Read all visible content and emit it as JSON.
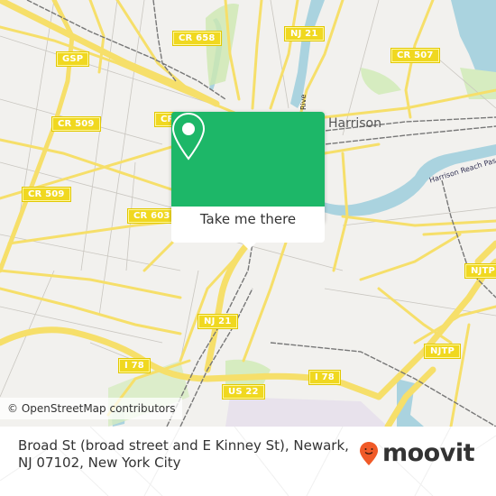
{
  "map": {
    "shields": [
      {
        "id": "cr658",
        "label": "CR 658"
      },
      {
        "id": "nj21-top",
        "label": "NJ 21"
      },
      {
        "id": "cr507",
        "label": "CR 507"
      },
      {
        "id": "gsp",
        "label": "GSP"
      },
      {
        "id": "cr509-a",
        "label": "CR 509"
      },
      {
        "id": "cr509-b",
        "label": "CR 509"
      },
      {
        "id": "cr603",
        "label": "CR 603"
      },
      {
        "id": "cr-partial",
        "label": "CR"
      },
      {
        "id": "nj21-mid",
        "label": "NJ 21"
      },
      {
        "id": "njtp-a",
        "label": "NJTP"
      },
      {
        "id": "nj21-low",
        "label": "NJ 21"
      },
      {
        "id": "i78-a",
        "label": "I 78"
      },
      {
        "id": "i78-b",
        "label": "I 78"
      },
      {
        "id": "njtp-b",
        "label": "NJTP"
      },
      {
        "id": "us22",
        "label": "US 22"
      }
    ],
    "places": {
      "harrison": "Harrison",
      "harrison_reach": "Harrison Reach Pass",
      "river": "Rive"
    },
    "attribution": "© OpenStreetMap contributors"
  },
  "popup": {
    "icon": "location-pin-icon",
    "button_label": "Take me there",
    "color": "#1db768"
  },
  "footer": {
    "address": "Broad St (broad street and E Kinney St), Newark, NJ 07102, New York City",
    "brand": "moovit",
    "brand_color": "#f05a28"
  }
}
